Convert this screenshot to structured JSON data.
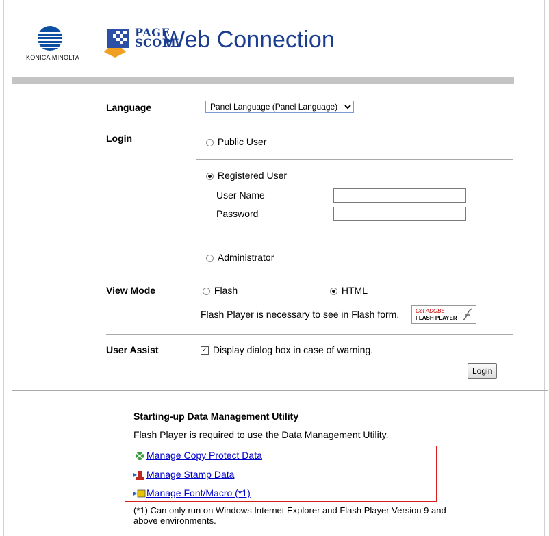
{
  "header": {
    "brand_text": "KONICA MINOLTA",
    "product_word_1": "PAGE",
    "product_word_2": "SCOPE",
    "product_title": "Web Connection"
  },
  "form": {
    "language": {
      "label": "Language",
      "selected": "Panel Language (Panel Language)"
    },
    "login": {
      "label": "Login",
      "public_user": "Public User",
      "registered_user": "Registered User",
      "user_name_label": "User Name",
      "password_label": "Password",
      "administrator": "Administrator",
      "selected": "Registered User"
    },
    "view_mode": {
      "label": "View Mode",
      "flash": "Flash",
      "html": "HTML",
      "selected": "HTML",
      "note": "Flash Player is necessary to see in Flash form.",
      "badge_line1": "Get ADOBE",
      "badge_line2": "FLASH PLAYER"
    },
    "user_assist": {
      "label": "User Assist",
      "checkbox_label": "Display dialog box in case of warning.",
      "checked": true
    },
    "login_button": "Login"
  },
  "utility": {
    "heading": "Starting-up Data Management Utility",
    "note": "Flash Player is required to use the Data Management Utility.",
    "links": [
      {
        "label": "Manage Copy Protect Data",
        "icon": "copy-protect-icon"
      },
      {
        "label": "Manage Stamp Data",
        "icon": "stamp-icon"
      },
      {
        "label": "Manage Font/Macro (*1)",
        "icon": "font-macro-icon"
      }
    ],
    "footnote_line1": "(*1) Can only run on Windows Internet Explorer and Flash Player Version 9 and",
    "footnote_line2": "above environments."
  },
  "colors": {
    "brand_blue": "#1a3d8f",
    "link": "#0000cc",
    "highlight_border": "#d62020"
  }
}
